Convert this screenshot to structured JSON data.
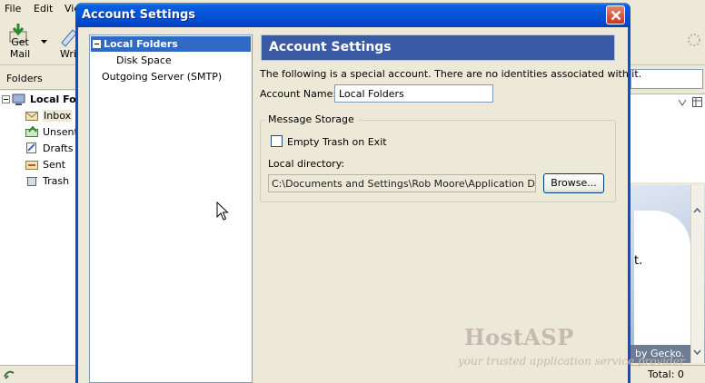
{
  "background_app": {
    "menus": [
      "File",
      "Edit",
      "Vie"
    ],
    "toolbar": {
      "get_mail_label": "Get Mail",
      "write_label": "Wri"
    },
    "folders_header": "Folders",
    "folder_tree": [
      {
        "label": "Local Fold",
        "icon": "computer-icon"
      },
      {
        "label": "Inbox",
        "icon": "inbox-icon"
      },
      {
        "label": "Unsent",
        "icon": "outbox-icon"
      },
      {
        "label": "Drafts",
        "icon": "drafts-icon"
      },
      {
        "label": "Sent",
        "icon": "sent-icon"
      },
      {
        "label": "Trash",
        "icon": "trash-icon"
      }
    ],
    "preview_fragment": "t.",
    "preview_band": "by Gecko.",
    "status_total": "Total: 0"
  },
  "dialog": {
    "title": "Account Settings",
    "tree": [
      {
        "label": "Local Folders",
        "selected": true
      },
      {
        "label": "Disk Space"
      },
      {
        "label": "Outgoing Server (SMTP)"
      }
    ],
    "panel_title": "Account Settings",
    "description": "The following is a special account. There are no identities associated with it.",
    "account_name_label": "Account Name:",
    "account_name_value": "Local Folders",
    "message_storage": {
      "title": "Message Storage",
      "empty_trash_label": "Empty Trash on Exit",
      "empty_trash_checked": false,
      "local_directory_label": "Local directory:",
      "local_directory_value": "C:\\Documents and Settings\\Rob Moore\\Application Data\\Thunderbird",
      "browse_label": "Browse..."
    }
  },
  "watermark": {
    "title": "HostASP",
    "subtitle": "your trusted application service provider"
  },
  "colors": {
    "title_bar": "#0554d9",
    "selection": "#316ac5",
    "panel_header": "#3a5aa6",
    "dialog_bg": "#ece9d8"
  }
}
